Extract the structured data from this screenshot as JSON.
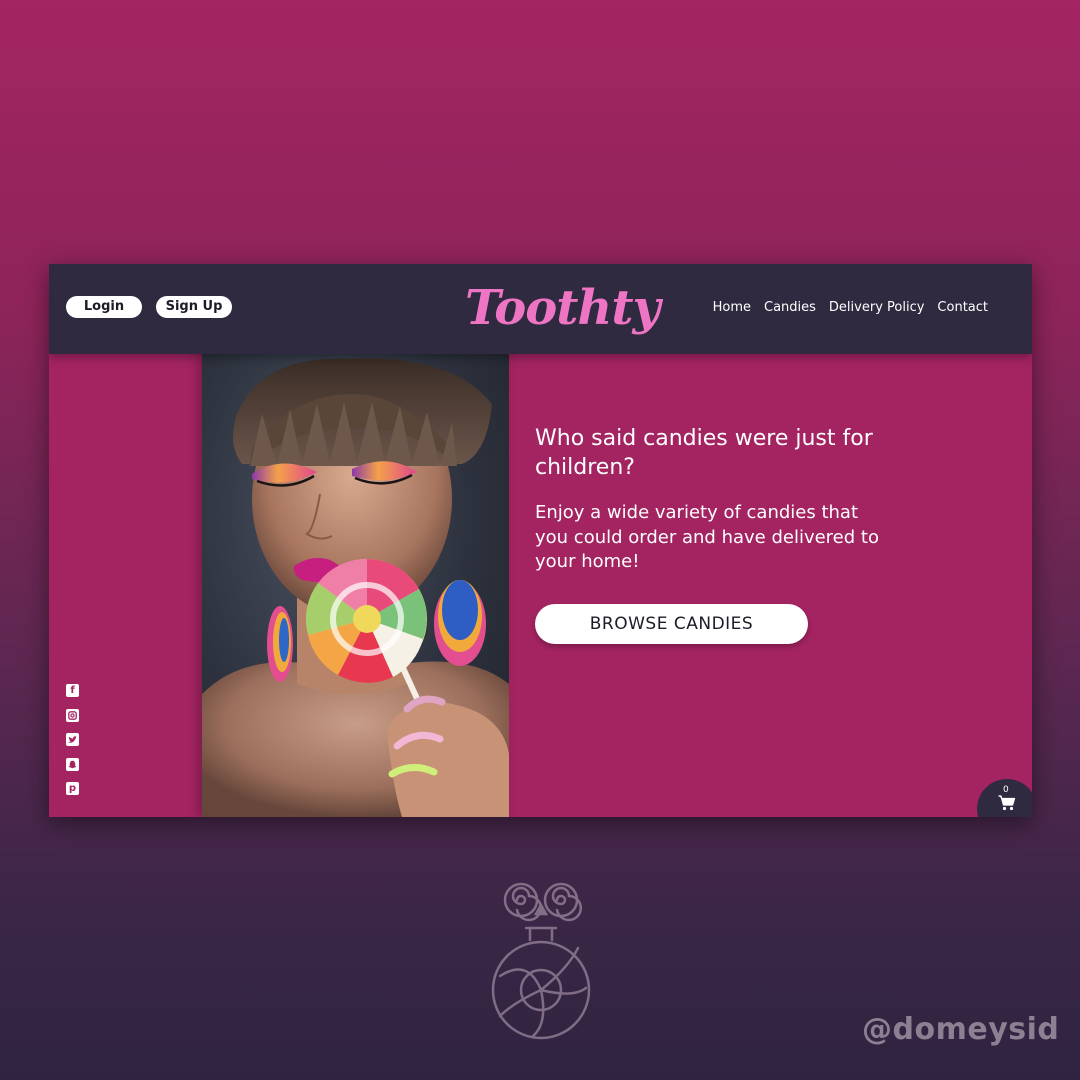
{
  "header": {
    "login_label": "Login",
    "signup_label": "Sign Up",
    "logo_text": "Toothty",
    "nav": [
      "Home",
      "Candies",
      "Delivery Policy",
      "Contact"
    ]
  },
  "hero": {
    "headline": "Who said candies were just for children?",
    "subtext": "Enjoy a wide variety of candies that you could order and have delivered to your home!",
    "cta_label": "BROWSE CANDIES"
  },
  "social_icons": [
    "facebook-icon",
    "instagram-icon",
    "twitter-icon",
    "snapchat-icon",
    "pinterest-icon"
  ],
  "cart": {
    "count": "0",
    "icon": "shopping-cart-icon"
  },
  "watermark": "@domeysid",
  "colors": {
    "navbar": "#302a40",
    "main": "#a42462",
    "logo": "#ee74c4",
    "button": "#ffffff"
  }
}
